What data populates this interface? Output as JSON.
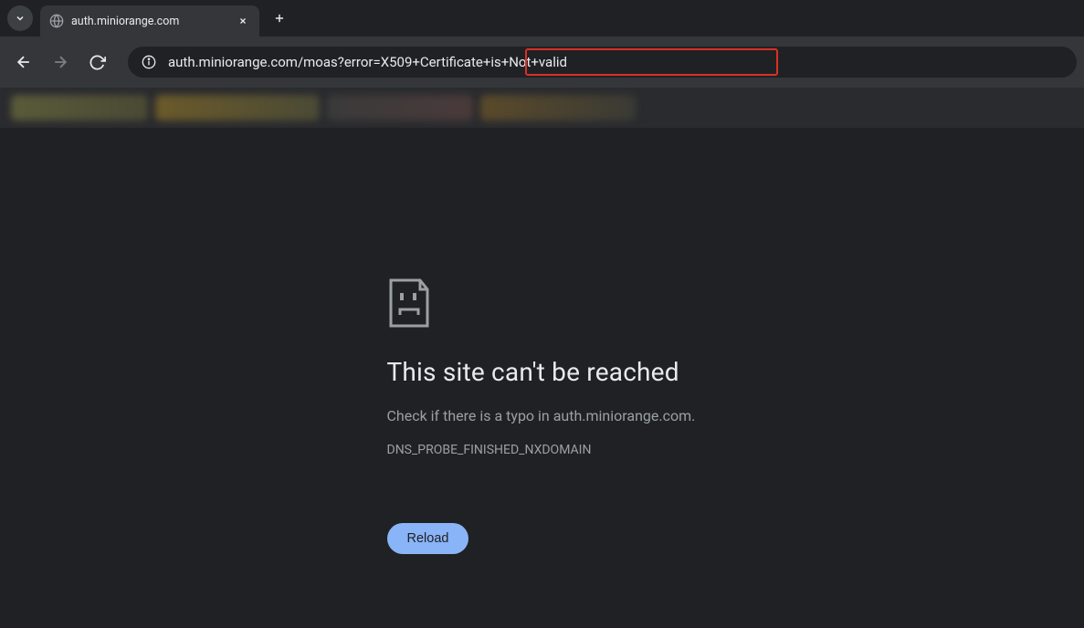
{
  "tab": {
    "title": "auth.miniorange.com"
  },
  "address": {
    "url_prefix": "auth.miniorange.com/moas?erro",
    "url_highlighted": "r=X509+Certificate+is+Not+valid"
  },
  "error": {
    "heading": "This site can't be reached",
    "sub": "Check if there is a typo in auth.miniorange.com.",
    "code": "DNS_PROBE_FINISHED_NXDOMAIN",
    "reload_label": "Reload"
  }
}
